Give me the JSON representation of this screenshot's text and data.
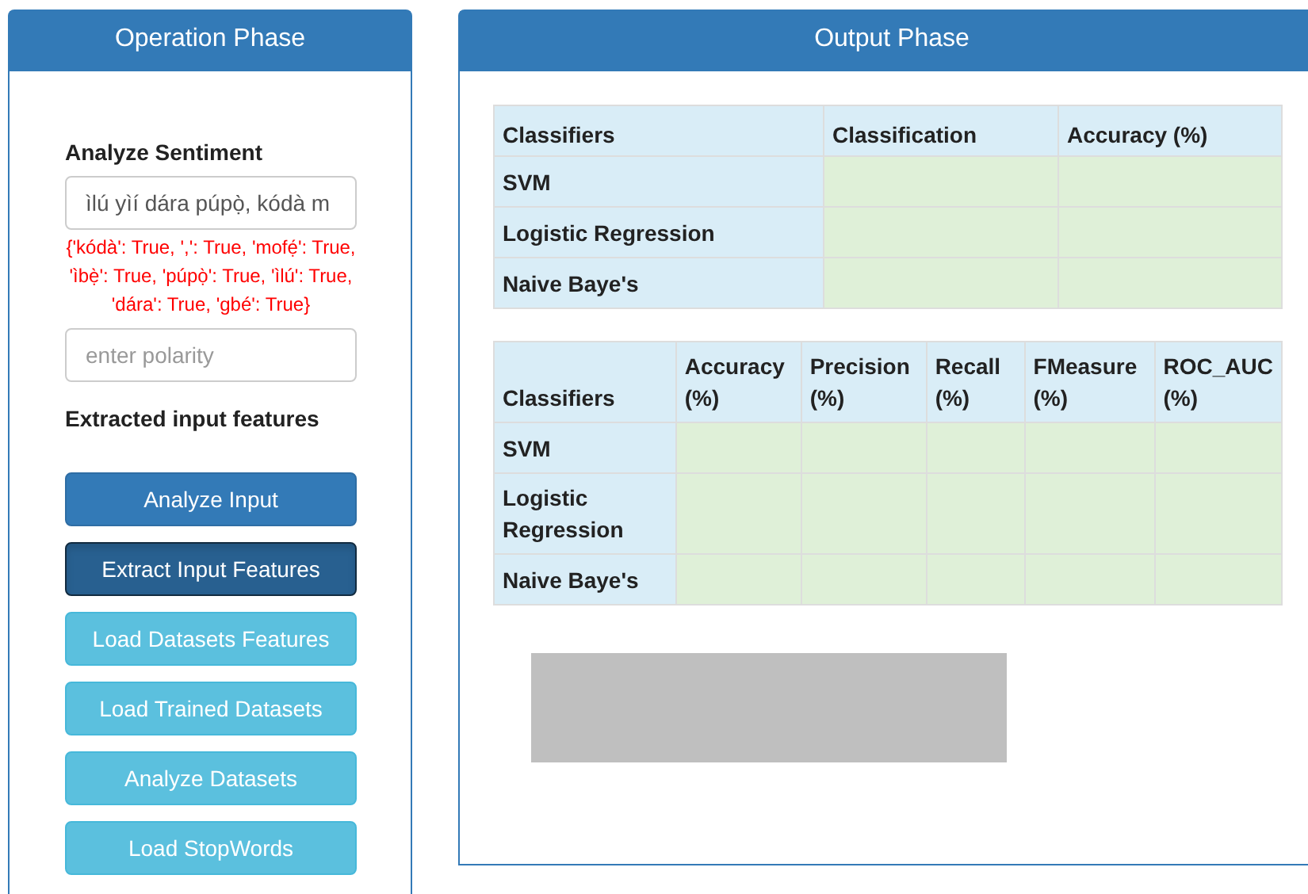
{
  "operation_panel": {
    "title": "Operation Phase",
    "analyze_label": "Analyze Sentiment",
    "sentence_field": {
      "value": "ìlú yìí dára púpọ̀, kódà m"
    },
    "features_output": "{'kódà': True, ',': True, 'mofẹ́': True, 'ìbẹ̀': True, 'púpọ̀': True, 'ìlú': True, 'dára': True, 'gbé': True}",
    "polarity_field": {
      "placeholder": "enter polarity"
    },
    "features_label": "Extracted input features",
    "buttons": [
      {
        "label": "Analyze Input",
        "kind": "primary",
        "pressed": false
      },
      {
        "label": "Extract Input Features",
        "kind": "primary",
        "pressed": true
      },
      {
        "label": "Load Datasets Features",
        "kind": "info",
        "pressed": false
      },
      {
        "label": "Load Trained Datasets",
        "kind": "info",
        "pressed": false
      },
      {
        "label": "Analyze Datasets",
        "kind": "info",
        "pressed": false
      },
      {
        "label": "Load StopWords",
        "kind": "info",
        "pressed": false
      }
    ]
  },
  "output_panel": {
    "title": "Output Phase",
    "tables": [
      {
        "columns": [
          "Classifiers",
          "Classification",
          "Accuracy (%)"
        ],
        "rows": [
          [
            "SVM",
            "",
            ""
          ],
          [
            "Logistic Regression",
            "",
            ""
          ],
          [
            "Naive Baye's",
            "",
            ""
          ]
        ]
      },
      {
        "columns": [
          "Classifiers",
          "Accuracy (%)",
          "Precision (%)",
          "Recall (%)",
          "FMeasure (%)",
          "ROC_AUC (%)"
        ],
        "rows": [
          [
            "SVM",
            "",
            "",
            "",
            "",
            ""
          ],
          [
            "Logistic Regression",
            "",
            "",
            "",
            "",
            ""
          ],
          [
            "Naive Baye's",
            "",
            "",
            "",
            "",
            ""
          ]
        ]
      }
    ]
  }
}
